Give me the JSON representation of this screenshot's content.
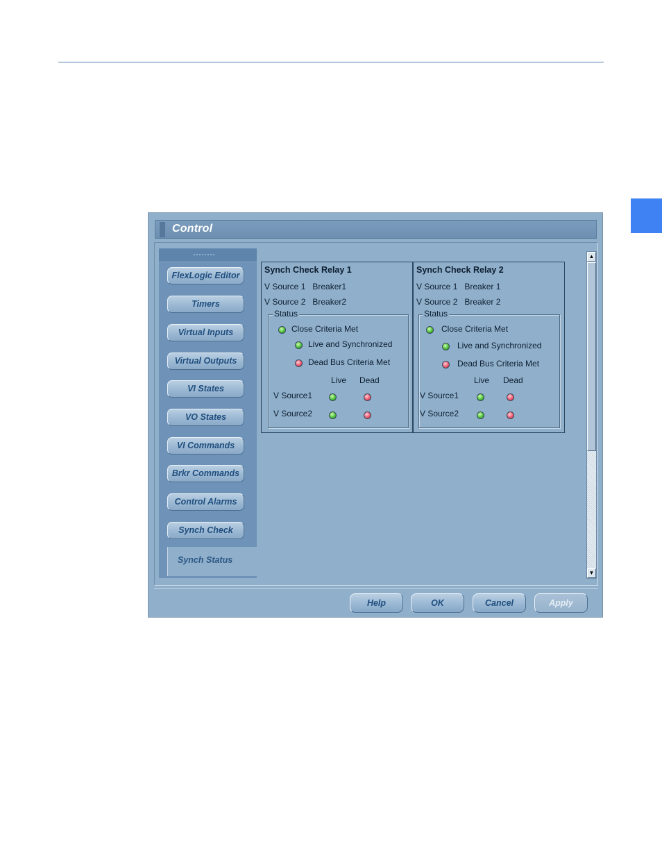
{
  "window": {
    "title": "Control"
  },
  "nav": {
    "items": [
      "FlexLogic Editor",
      "Timers",
      "Virtual Inputs",
      "Virtual Outputs",
      "VI States",
      "VO States",
      "VI Commands",
      "Brkr Commands",
      "Control Alarms",
      "Synch Check"
    ],
    "selected": "Synch Status"
  },
  "relays": [
    {
      "title": "Synch Check Relay 1",
      "vsource1": {
        "label": "V Source 1",
        "value": "Breaker1"
      },
      "vsource2": {
        "label": "V Source 2",
        "value": "Breaker2"
      },
      "status_label": "Status",
      "close_criteria": "Close Criteria Met",
      "live_sync": "Live and Synchronized",
      "dead_bus": "Dead Bus Criteria Met",
      "col_live": "Live",
      "col_dead": "Dead",
      "row1": "V Source1",
      "row2": "V Source2"
    },
    {
      "title": "Synch Check Relay 2",
      "vsource1": {
        "label": "V Source 1",
        "value": "Breaker 1"
      },
      "vsource2": {
        "label": "V Source 2",
        "value": "Breaker 2"
      },
      "status_label": "Status",
      "close_criteria": "Close Criteria Met",
      "live_sync": "Live and Synchronized",
      "dead_bus": "Dead Bus Criteria Met",
      "col_live": "Live",
      "col_dead": "Dead",
      "row1": "V Source1",
      "row2": "V Source2"
    }
  ],
  "indicators": {
    "close_criteria": "green",
    "live_sync": "green",
    "dead_bus": "red",
    "source1_live": "green",
    "source1_dead": "red",
    "source2_live": "green",
    "source2_dead": "red"
  },
  "buttons": {
    "help": "Help",
    "ok": "OK",
    "cancel": "Cancel",
    "apply": "Apply"
  },
  "colors": {
    "accent_tab": "#3f82f4",
    "panel": "#8fafcb",
    "button_text": "#1f4e7e"
  }
}
